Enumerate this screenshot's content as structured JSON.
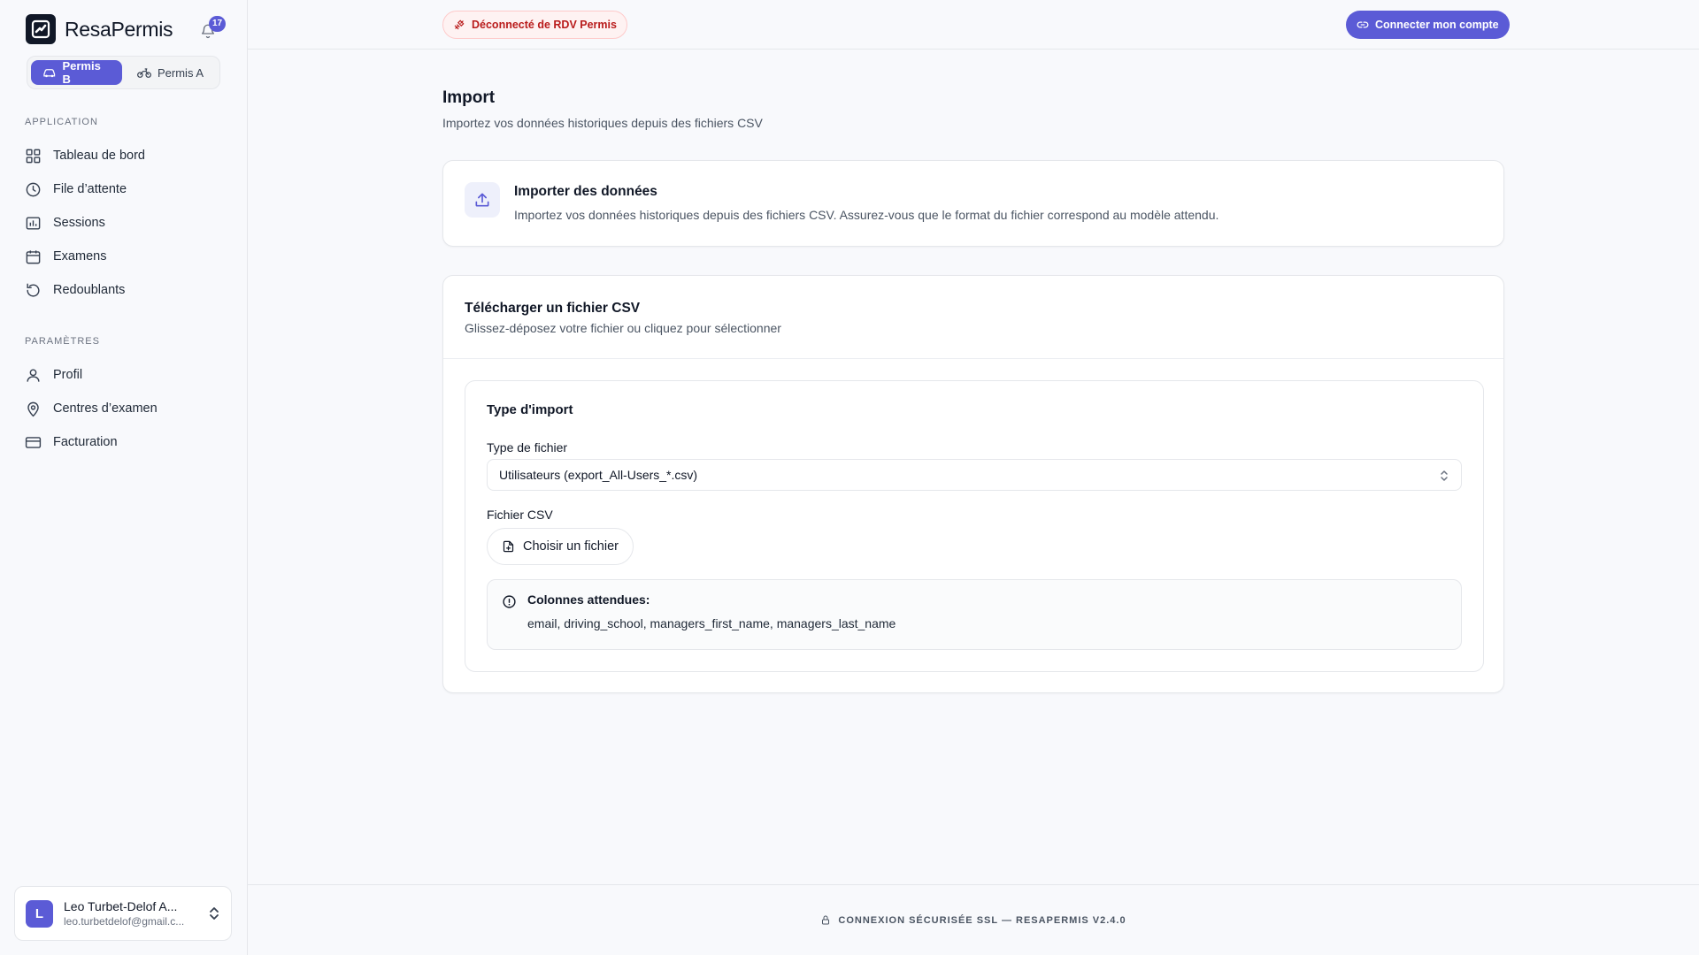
{
  "app": {
    "name": "ResaPermis",
    "notification_count": "17"
  },
  "permis": {
    "active": "Permis B",
    "inactive": "Permis A"
  },
  "sidebar": {
    "section_app": "APPLICATION",
    "app_items": [
      {
        "label": "Tableau de bord",
        "icon": "grid-icon"
      },
      {
        "label": "File d’attente",
        "icon": "clock-icon"
      },
      {
        "label": "Sessions",
        "icon": "chart-icon"
      },
      {
        "label": "Examens",
        "icon": "calendar-icon"
      },
      {
        "label": "Redoublants",
        "icon": "rotate-icon"
      }
    ],
    "section_settings": "PARAMÈTRES",
    "settings_items": [
      {
        "label": "Profil",
        "icon": "user-icon"
      },
      {
        "label": "Centres d’examen",
        "icon": "map-pin-icon"
      },
      {
        "label": "Facturation",
        "icon": "credit-card-icon"
      }
    ]
  },
  "user": {
    "initial": "L",
    "name": "Leo Turbet-Delof A...",
    "email": "leo.turbetdelof@gmail.c..."
  },
  "topbar": {
    "disconnected_label": "Déconnecté de RDV Permis",
    "connect_label": "Connecter mon compte"
  },
  "page": {
    "title": "Import",
    "subtitle": "Importez vos données historiques depuis des fichiers CSV"
  },
  "import_card": {
    "title": "Importer des données",
    "description": "Importez vos données historiques depuis des fichiers CSV. Assurez-vous que le format du fichier correspond au modèle attendu."
  },
  "upload_card": {
    "title": "Télécharger un fichier CSV",
    "subtitle": "Glissez-déposez votre fichier ou cliquez pour sélectionner",
    "section_title": "Type d'import",
    "file_type_label": "Type de fichier",
    "file_type_value": "Utilisateurs (export_All-Users_*.csv)",
    "csv_label": "Fichier CSV",
    "choose_file_label": "Choisir un fichier",
    "columns_title": "Colonnes attendues:",
    "columns_value": "email, driving_school, managers_first_name, managers_last_name"
  },
  "footer": {
    "text": "CONNEXION SÉCURISÉE SSL — RESAPERMIS V2.4.0"
  },
  "colors": {
    "accent": "#5b5bd6",
    "danger": "#b91c1c"
  }
}
